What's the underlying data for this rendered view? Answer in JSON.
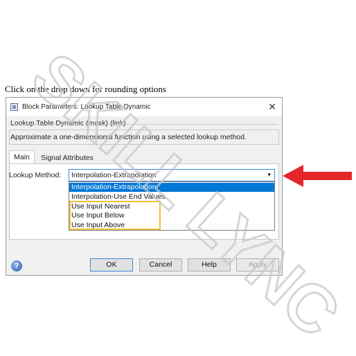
{
  "caption": "Click on the drop down for rounding options",
  "dialog": {
    "title": "Block Parameters: Lookup Table Dynamic",
    "close_glyph": "✕",
    "mask_label": "Lookup Table Dynamic (mask) (link)",
    "description": "Approximate a one-dimensional function using a selected lookup method.",
    "tabs": [
      "Main",
      "Signal Attributes"
    ],
    "lookup_method_label": "Lookup Method:",
    "lookup_method_value": "Interpolation-Extrapolation",
    "dropdown_arrow": "▾",
    "options": [
      "Interpolation-Extrapolation",
      "Interpolation-Use End Values",
      "Use Input Nearest",
      "Use Input Below",
      "Use Input Above"
    ],
    "buttons": {
      "ok": "OK",
      "cancel": "Cancel",
      "help": "Help",
      "apply": "Apply"
    },
    "help_glyph": "?"
  },
  "watermark": "SKILL LYNC",
  "colors": {
    "highlight": "#f3c036",
    "selection": "#0078d7",
    "arrow": "#e3262a"
  }
}
